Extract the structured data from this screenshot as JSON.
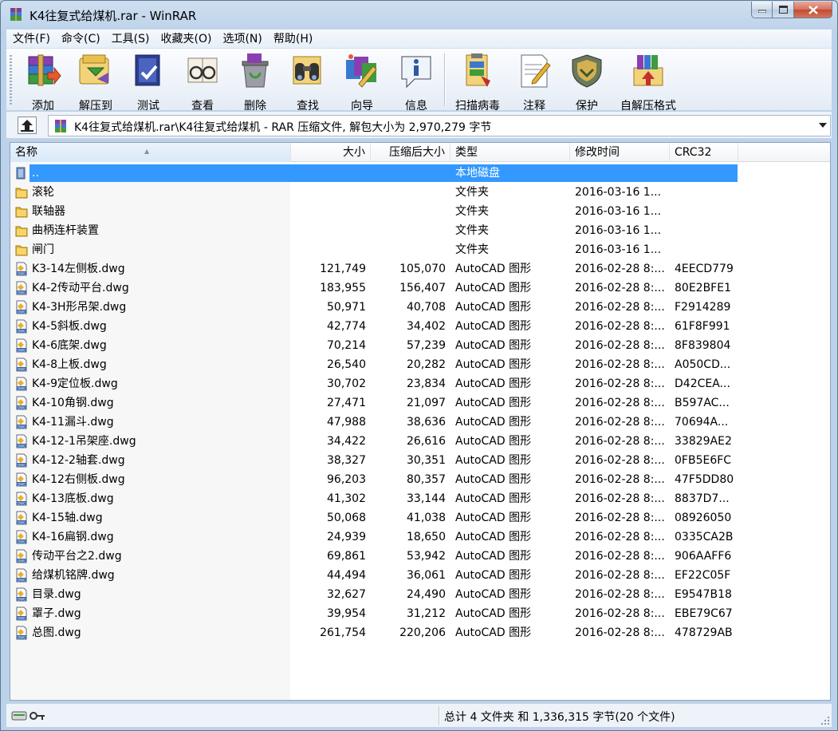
{
  "window": {
    "title": "K4往复式给煤机.rar - WinRAR",
    "controls": {
      "minimize": "minimize-icon",
      "maximize": "maximize-icon",
      "close": "close-icon"
    }
  },
  "menu": [
    "文件(F)",
    "命令(C)",
    "工具(S)",
    "收藏夹(O)",
    "选项(N)",
    "帮助(H)"
  ],
  "toolbar": [
    {
      "label": "添加",
      "icon": "add-archive-icon"
    },
    {
      "label": "解压到",
      "icon": "extract-to-icon"
    },
    {
      "label": "测试",
      "icon": "test-icon"
    },
    {
      "label": "查看",
      "icon": "view-icon"
    },
    {
      "label": "删除",
      "icon": "delete-icon"
    },
    {
      "label": "查找",
      "icon": "find-icon"
    },
    {
      "label": "向导",
      "icon": "wizard-icon"
    },
    {
      "label": "信息",
      "icon": "info-icon"
    },
    {
      "label": "扫描病毒",
      "icon": "virus-scan-icon"
    },
    {
      "label": "注释",
      "icon": "comment-icon"
    },
    {
      "label": "保护",
      "icon": "protect-icon"
    },
    {
      "label": "自解压格式",
      "icon": "sfx-icon"
    }
  ],
  "address": {
    "path": "K4往复式给煤机.rar\\K4往复式给煤机 - RAR 压缩文件, 解包大小为 2,970,279 字节"
  },
  "columns": {
    "name": "名称",
    "size": "大小",
    "packed": "压缩后大小",
    "type": "类型",
    "modified": "修改时间",
    "crc": "CRC32"
  },
  "files": [
    {
      "name": "..",
      "size": "",
      "packed": "",
      "type": "本地磁盘",
      "modified": "",
      "crc": "",
      "kind": "parent",
      "selected": true
    },
    {
      "name": "滚轮",
      "size": "",
      "packed": "",
      "type": "文件夹",
      "modified": "2016-03-16 1...",
      "crc": "",
      "kind": "folder"
    },
    {
      "name": "联轴器",
      "size": "",
      "packed": "",
      "type": "文件夹",
      "modified": "2016-03-16 1...",
      "crc": "",
      "kind": "folder"
    },
    {
      "name": "曲柄连杆装置",
      "size": "",
      "packed": "",
      "type": "文件夹",
      "modified": "2016-03-16 1...",
      "crc": "",
      "kind": "folder"
    },
    {
      "name": "闸门",
      "size": "",
      "packed": "",
      "type": "文件夹",
      "modified": "2016-03-16 1...",
      "crc": "",
      "kind": "folder"
    },
    {
      "name": "K3-14左侧板.dwg",
      "size": "121,749",
      "packed": "105,070",
      "type": "AutoCAD 图形",
      "modified": "2016-02-28 8:...",
      "crc": "4EECD779",
      "kind": "dwg"
    },
    {
      "name": "K4-2传动平台.dwg",
      "size": "183,955",
      "packed": "156,407",
      "type": "AutoCAD 图形",
      "modified": "2016-02-28 8:...",
      "crc": "80E2BFE1",
      "kind": "dwg"
    },
    {
      "name": "K4-3H形吊架.dwg",
      "size": "50,971",
      "packed": "40,708",
      "type": "AutoCAD 图形",
      "modified": "2016-02-28 8:...",
      "crc": "F2914289",
      "kind": "dwg"
    },
    {
      "name": "K4-5斜板.dwg",
      "size": "42,774",
      "packed": "34,402",
      "type": "AutoCAD 图形",
      "modified": "2016-02-28 8:...",
      "crc": "61F8F991",
      "kind": "dwg"
    },
    {
      "name": "K4-6底架.dwg",
      "size": "70,214",
      "packed": "57,239",
      "type": "AutoCAD 图形",
      "modified": "2016-02-28 8:...",
      "crc": "8F839804",
      "kind": "dwg"
    },
    {
      "name": "K4-8上板.dwg",
      "size": "26,540",
      "packed": "20,282",
      "type": "AutoCAD 图形",
      "modified": "2016-02-28 8:...",
      "crc": "A050CD...",
      "kind": "dwg"
    },
    {
      "name": "K4-9定位板.dwg",
      "size": "30,702",
      "packed": "23,834",
      "type": "AutoCAD 图形",
      "modified": "2016-02-28 8:...",
      "crc": "D42CEA...",
      "kind": "dwg"
    },
    {
      "name": "K4-10角钢.dwg",
      "size": "27,471",
      "packed": "21,097",
      "type": "AutoCAD 图形",
      "modified": "2016-02-28 8:...",
      "crc": "B597AC...",
      "kind": "dwg"
    },
    {
      "name": "K4-11漏斗.dwg",
      "size": "47,988",
      "packed": "38,636",
      "type": "AutoCAD 图形",
      "modified": "2016-02-28 8:...",
      "crc": "70694A...",
      "kind": "dwg"
    },
    {
      "name": "K4-12-1吊架座.dwg",
      "size": "34,422",
      "packed": "26,616",
      "type": "AutoCAD 图形",
      "modified": "2016-02-28 8:...",
      "crc": "33829AE2",
      "kind": "dwg"
    },
    {
      "name": "K4-12-2轴套.dwg",
      "size": "38,327",
      "packed": "30,351",
      "type": "AutoCAD 图形",
      "modified": "2016-02-28 8:...",
      "crc": "0FB5E6FC",
      "kind": "dwg"
    },
    {
      "name": "K4-12右侧板.dwg",
      "size": "96,203",
      "packed": "80,357",
      "type": "AutoCAD 图形",
      "modified": "2016-02-28 8:...",
      "crc": "47F5DD80",
      "kind": "dwg"
    },
    {
      "name": "K4-13底板.dwg",
      "size": "41,302",
      "packed": "33,144",
      "type": "AutoCAD 图形",
      "modified": "2016-02-28 8:...",
      "crc": "8837D7...",
      "kind": "dwg"
    },
    {
      "name": "K4-15轴.dwg",
      "size": "50,068",
      "packed": "41,038",
      "type": "AutoCAD 图形",
      "modified": "2016-02-28 8:...",
      "crc": "08926050",
      "kind": "dwg"
    },
    {
      "name": "K4-16扁钢.dwg",
      "size": "24,939",
      "packed": "18,650",
      "type": "AutoCAD 图形",
      "modified": "2016-02-28 8:...",
      "crc": "0335CA2B",
      "kind": "dwg"
    },
    {
      "name": "传动平台之2.dwg",
      "size": "69,861",
      "packed": "53,942",
      "type": "AutoCAD 图形",
      "modified": "2016-02-28 8:...",
      "crc": "906AAFF6",
      "kind": "dwg"
    },
    {
      "name": "给煤机铭牌.dwg",
      "size": "44,494",
      "packed": "36,061",
      "type": "AutoCAD 图形",
      "modified": "2016-02-28 8:...",
      "crc": "EF22C05F",
      "kind": "dwg"
    },
    {
      "name": "目录.dwg",
      "size": "32,627",
      "packed": "24,490",
      "type": "AutoCAD 图形",
      "modified": "2016-02-28 8:...",
      "crc": "E9547B18",
      "kind": "dwg"
    },
    {
      "name": "罩子.dwg",
      "size": "39,954",
      "packed": "31,212",
      "type": "AutoCAD 图形",
      "modified": "2016-02-28 8:...",
      "crc": "EBE79C67",
      "kind": "dwg"
    },
    {
      "name": "总图.dwg",
      "size": "261,754",
      "packed": "220,206",
      "type": "AutoCAD 图形",
      "modified": "2016-02-28 8:...",
      "crc": "478729AB",
      "kind": "dwg"
    }
  ],
  "status": {
    "text": "总计 4 文件夹 和 1,336,315 字节(20 个文件)"
  },
  "colors": {
    "selection": "#3399ff",
    "folder": "#e8b83a",
    "dwg": "#2d5fa8"
  }
}
